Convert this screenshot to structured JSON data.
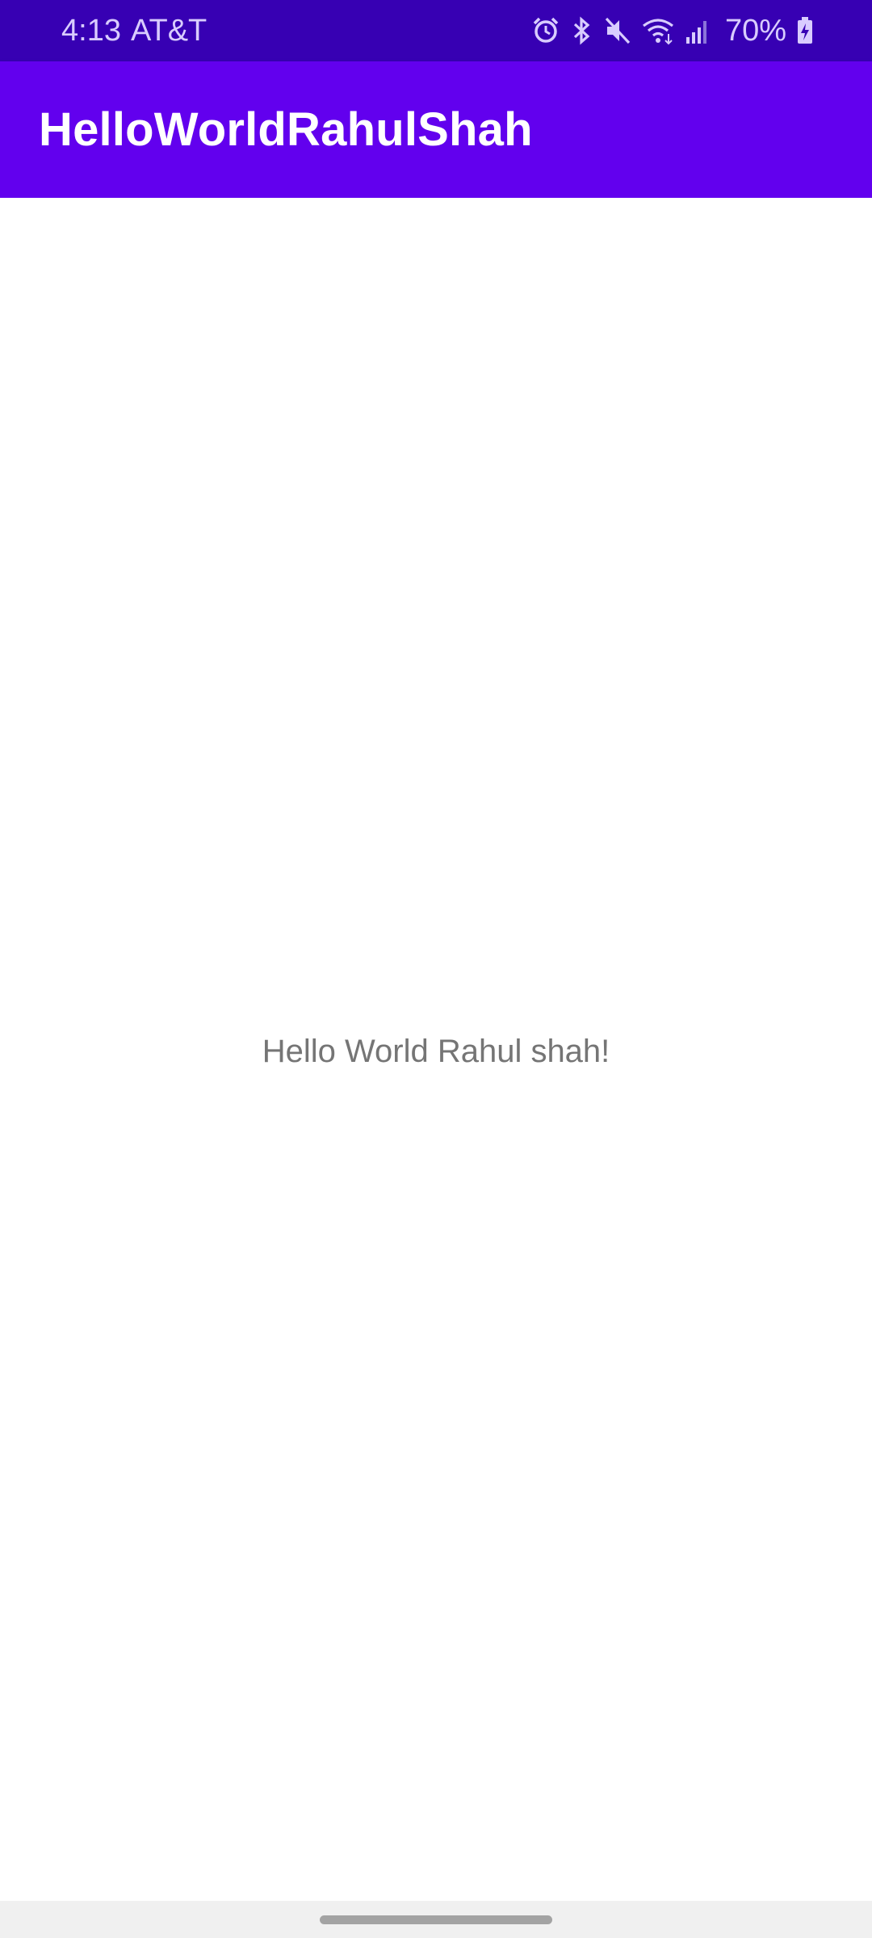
{
  "status_bar": {
    "time": "4:13",
    "carrier": "AT&T",
    "battery_percent": "70%",
    "icons": [
      "alarm-icon",
      "bluetooth-icon",
      "mute-icon",
      "wifi-icon",
      "signal-icon",
      "battery-charging-icon"
    ],
    "background_color": "#3700b3"
  },
  "app_bar": {
    "title": "HelloWorldRahulShah",
    "background_color": "#6200ee"
  },
  "main": {
    "message": "Hello World Rahul shah!"
  },
  "nav_bar": {
    "handle": "home-gesture-handle"
  }
}
